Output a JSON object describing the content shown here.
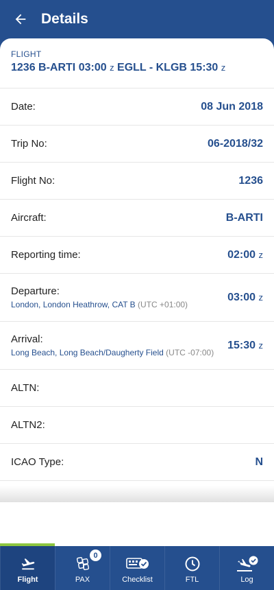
{
  "header": {
    "title": "Details",
    "back_icon": "arrow-left-icon"
  },
  "flight": {
    "caption": "FLIGHT",
    "summary_main": "1236 B-ARTI 03:00",
    "summary_z1": "z",
    "summary_route": "EGLL - KLGB 15:30",
    "summary_z2": "z"
  },
  "rows": {
    "date": {
      "label": "Date:",
      "value": "08 Jun 2018"
    },
    "trip": {
      "label": "Trip No:",
      "value": "06-2018/32"
    },
    "flight_no": {
      "label": "Flight No:",
      "value": "1236"
    },
    "aircraft": {
      "label": "Aircraft:",
      "value": "B-ARTI"
    },
    "reporting": {
      "label": "Reporting time:",
      "value": "02:00",
      "unit": "z"
    },
    "departure": {
      "label": "Departure:",
      "sub": "London, London Heathrow, CAT B",
      "utc": "(UTC +01:00)",
      "value": "03:00",
      "unit": "z"
    },
    "arrival": {
      "label": "Arrival:",
      "sub": "Long Beach, Long Beach/Daugherty Field",
      "utc": "(UTC -07:00)",
      "value": "15:30",
      "unit": "z"
    },
    "altn": {
      "label": "ALTN:"
    },
    "altn2": {
      "label": "ALTN2:"
    },
    "icao": {
      "label": "ICAO Type:",
      "value": "N"
    }
  },
  "tabs": [
    {
      "label": "Flight",
      "icon": "plane-takeoff-icon",
      "active": true
    },
    {
      "label": "PAX",
      "icon": "seats-icon",
      "badge": "0"
    },
    {
      "label": "Checklist",
      "icon": "checklist-icon"
    },
    {
      "label": "FTL",
      "icon": "clock-icon"
    },
    {
      "label": "Log",
      "icon": "plane-landing-check-icon"
    }
  ],
  "colors": {
    "primary": "#254f8e",
    "accent": "#8dc63f"
  }
}
